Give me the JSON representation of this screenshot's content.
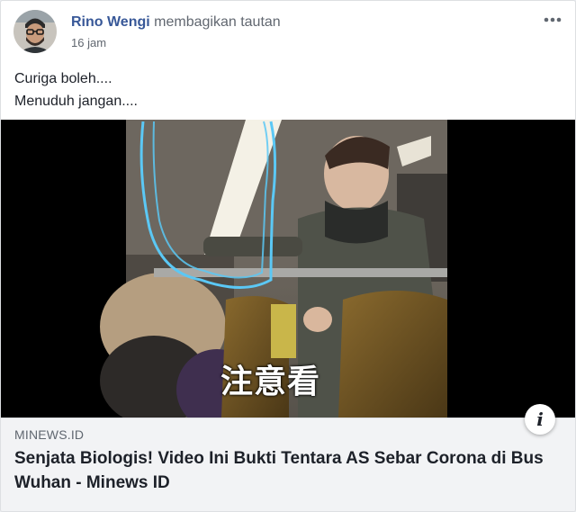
{
  "post": {
    "author": "Rino Wengi",
    "action": "membagikan tautan",
    "timestamp": "16 jam",
    "text_lines": [
      "Curiga boleh....",
      "Menuduh jangan...."
    ]
  },
  "icons": {
    "more": "more-dots-icon",
    "info": "info-icon"
  },
  "media": {
    "caption_overlay": "注意看"
  },
  "link_preview": {
    "domain": "MINEWS.ID",
    "title": "Senjata Biologis! Video Ini Bukti Tentara AS Sebar Corona di Bus Wuhan - Minews ID",
    "info_glyph": "i"
  },
  "colors": {
    "author_link": "#385898",
    "secondary_text": "#616770",
    "footer_background": "#f2f3f5",
    "highlight_outline": "#5bc8f5"
  }
}
